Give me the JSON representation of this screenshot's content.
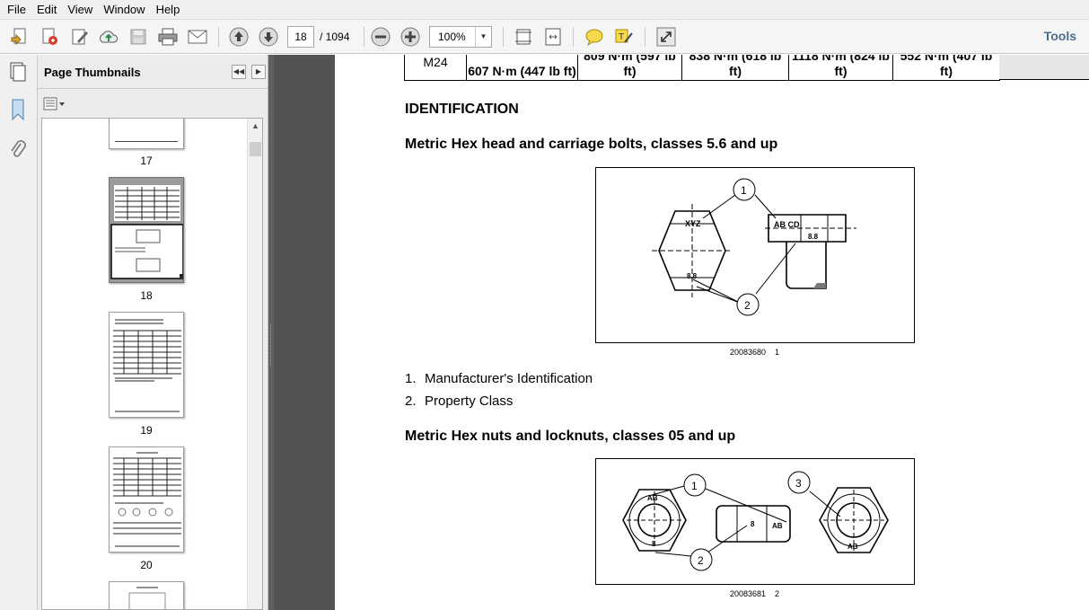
{
  "menu": [
    "File",
    "Edit",
    "View",
    "Window",
    "Help"
  ],
  "toolbar": {
    "current_page": "18",
    "page_total": "/ 1094",
    "zoom": "100%",
    "tools_label": "Tools"
  },
  "icons": {
    "create": "create-pdf-icon",
    "edit": "edit-pdf-icon",
    "sign": "sign-icon",
    "upload": "upload-cloud-icon",
    "save": "save-icon",
    "print": "print-icon",
    "email": "email-icon",
    "prev": "previous-page-icon",
    "next": "next-page-icon",
    "zoom_out": "zoom-out-icon",
    "zoom_in": "zoom-in-icon",
    "fit_page": "fit-page-icon",
    "fit_width": "fit-width-icon",
    "comment": "comment-icon",
    "highlight": "highlight-icon",
    "expand": "full-screen-icon"
  },
  "sidebar": {
    "title": "Page Thumbnails",
    "thumbnails": [
      {
        "label": "17"
      },
      {
        "label": "18"
      },
      {
        "label": "19"
      },
      {
        "label": "20"
      }
    ]
  },
  "document": {
    "torque_row": {
      "size": "M24",
      "cells": [
        "607 N·m (447 lb ft)",
        "809 N·m (597 lb ft)",
        "838 N·m (618 lb ft)",
        "1118 N·m (824 lb ft)",
        "552 N·m (407 lb ft)"
      ]
    },
    "section_title": "IDENTIFICATION",
    "subsection1": "Metric Hex head and carriage bolts, classes 5.6 and up",
    "figure1": {
      "code": "20083680",
      "number": "1",
      "callouts": [
        "1",
        "2"
      ],
      "marks": {
        "maker": "XYZ",
        "class_head": "8.8",
        "carriage_code": "AB CD",
        "carriage_class": "8.8"
      }
    },
    "legend": [
      {
        "num": "1.",
        "text": "Manufacturer's Identification"
      },
      {
        "num": "2.",
        "text": "Property Class"
      }
    ],
    "subsection2": "Metric Hex nuts and locknuts, classes 05 and up",
    "figure2": {
      "code": "20083681",
      "number": "2",
      "callouts": [
        "1",
        "2",
        "3"
      ],
      "marks": {
        "maker": "AB",
        "class": "8"
      }
    }
  }
}
